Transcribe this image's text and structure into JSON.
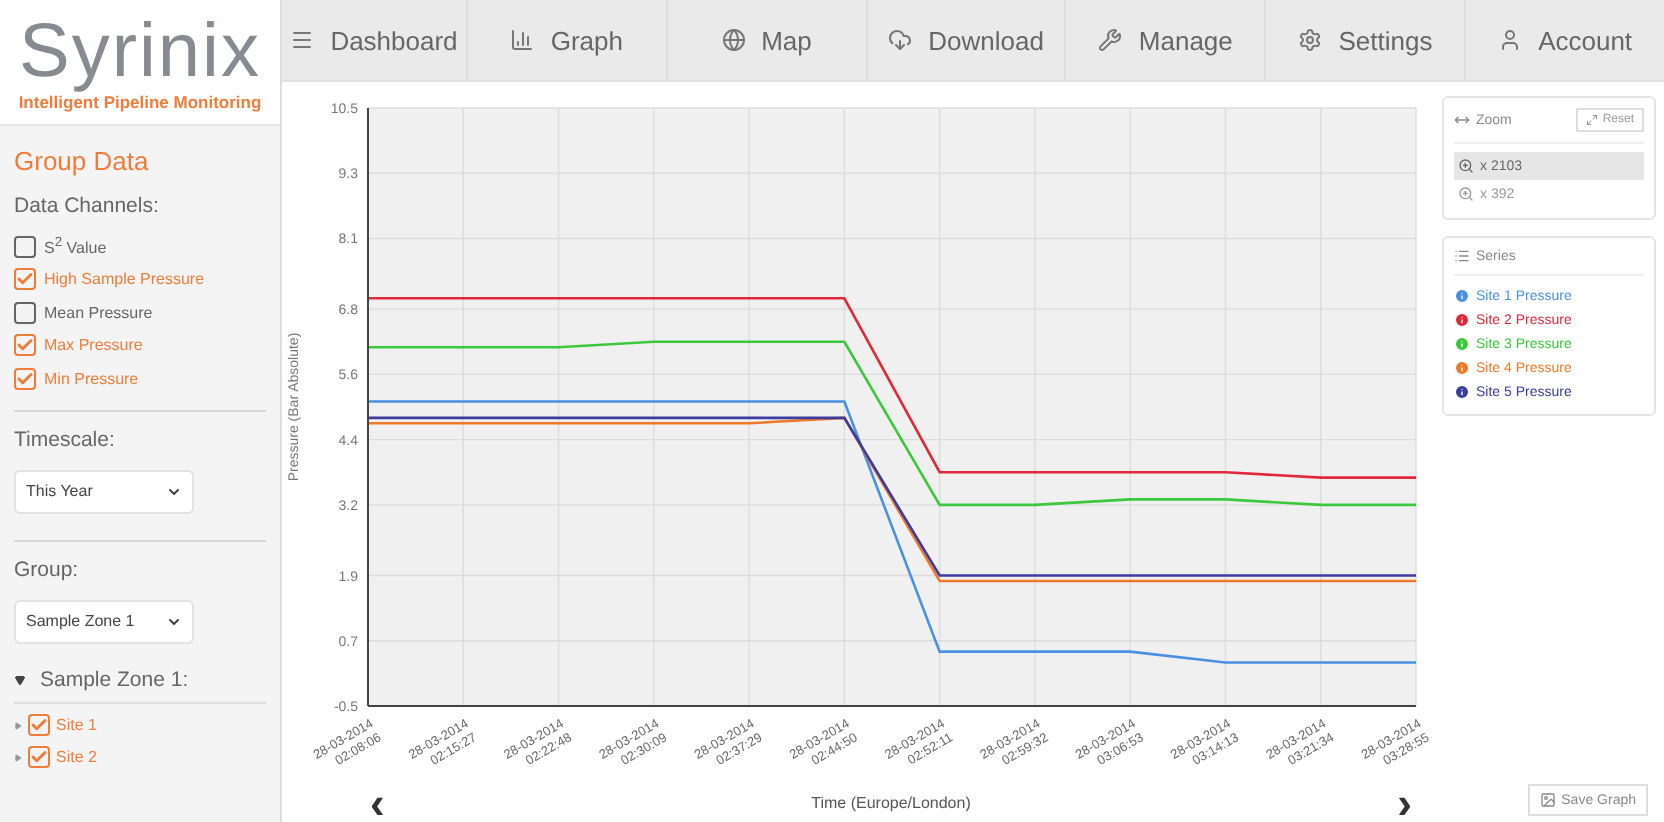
{
  "logo": {
    "name": "Syrinix",
    "tagline": "Intelligent Pipeline Monitoring"
  },
  "nav": [
    {
      "label": "Dashboard"
    },
    {
      "label": "Graph"
    },
    {
      "label": "Map"
    },
    {
      "label": "Download"
    },
    {
      "label": "Manage"
    },
    {
      "label": "Settings"
    },
    {
      "label": "Account"
    }
  ],
  "sidebar": {
    "title": "Group Data",
    "channels_label": "Data Channels:",
    "channels": [
      {
        "label": "S$^{2}$ Value",
        "checked": false
      },
      {
        "label": "High Sample Pressure",
        "checked": true
      },
      {
        "label": "Mean Pressure",
        "checked": false
      },
      {
        "label": "Max Pressure",
        "checked": true
      },
      {
        "label": "Min Pressure",
        "checked": true
      }
    ],
    "timescale_label": "Timescale:",
    "timescale": "This Year",
    "group_label": "Group:",
    "group": "Sample Zone 1",
    "tree": {
      "label": "Sample Zone 1:",
      "expanded": true,
      "children": [
        {
          "label": "Site 1",
          "checked": true
        },
        {
          "label": "Site 2",
          "checked": true
        }
      ]
    }
  },
  "chart": {
    "prev": "‹",
    "next": "›",
    "chart_data": {
      "type": "line",
      "grid": true,
      "xlabel": "Time (Europe/London)",
      "ylabel": "Pressure (Bar Absolute)",
      "categories": [
        "28-03-2014 02:08:06",
        "28-03-2014 02:15:27",
        "28-03-2014 02:22:48",
        "28-03-2014 02:30:09",
        "28-03-2014 02:37:29",
        "28-03-2014 02:44:50",
        "28-03-2014 02:52:11",
        "28-03-2014 02:59:32",
        "28-03-2014 03:06:53",
        "28-03-2014 03:14:13",
        "28-03-2014 03:21:34",
        "28-03-2014 03:28:55"
      ],
      "ylim": [
        -0.5,
        10.5
      ],
      "yticks": [
        -0.5,
        0.7,
        1.9,
        3.2,
        4.4,
        5.6,
        6.8,
        8.1,
        9.3,
        10.5
      ],
      "series": [
        {
          "name": "Site 1 Pressure",
          "color": "#4a90e2",
          "values": [
            5.1,
            5.1,
            5.1,
            5.1,
            5.1,
            5.1,
            0.5,
            0.5,
            0.5,
            0.3,
            0.3,
            0.3
          ]
        },
        {
          "name": "Site 2 Pressure",
          "color": "#e0283c",
          "values": [
            7.0,
            7.0,
            7.0,
            7.0,
            7.0,
            7.0,
            3.8,
            3.8,
            3.8,
            3.8,
            3.7,
            3.7
          ]
        },
        {
          "name": "Site 3 Pressure",
          "color": "#3cc83c",
          "values": [
            6.1,
            6.1,
            6.1,
            6.2,
            6.2,
            6.2,
            3.2,
            3.2,
            3.3,
            3.3,
            3.2,
            3.2
          ]
        },
        {
          "name": "Site 4 Pressure",
          "color": "#f07828",
          "values": [
            4.7,
            4.7,
            4.7,
            4.7,
            4.7,
            4.8,
            1.8,
            1.8,
            1.8,
            1.8,
            1.8,
            1.8
          ]
        },
        {
          "name": "Site 5 Pressure",
          "color": "#3c3ca0",
          "values": [
            4.8,
            4.8,
            4.8,
            4.8,
            4.8,
            4.8,
            1.9,
            1.9,
            1.9,
            1.9,
            1.9,
            1.9
          ]
        }
      ]
    }
  },
  "zoom": {
    "title": "Zoom",
    "reset": "Reset",
    "levels": [
      {
        "label": "x 2103",
        "selected": true
      },
      {
        "label": "x 392",
        "selected": false
      }
    ]
  },
  "series_panel": {
    "title": "Series"
  },
  "save": "Save Graph"
}
